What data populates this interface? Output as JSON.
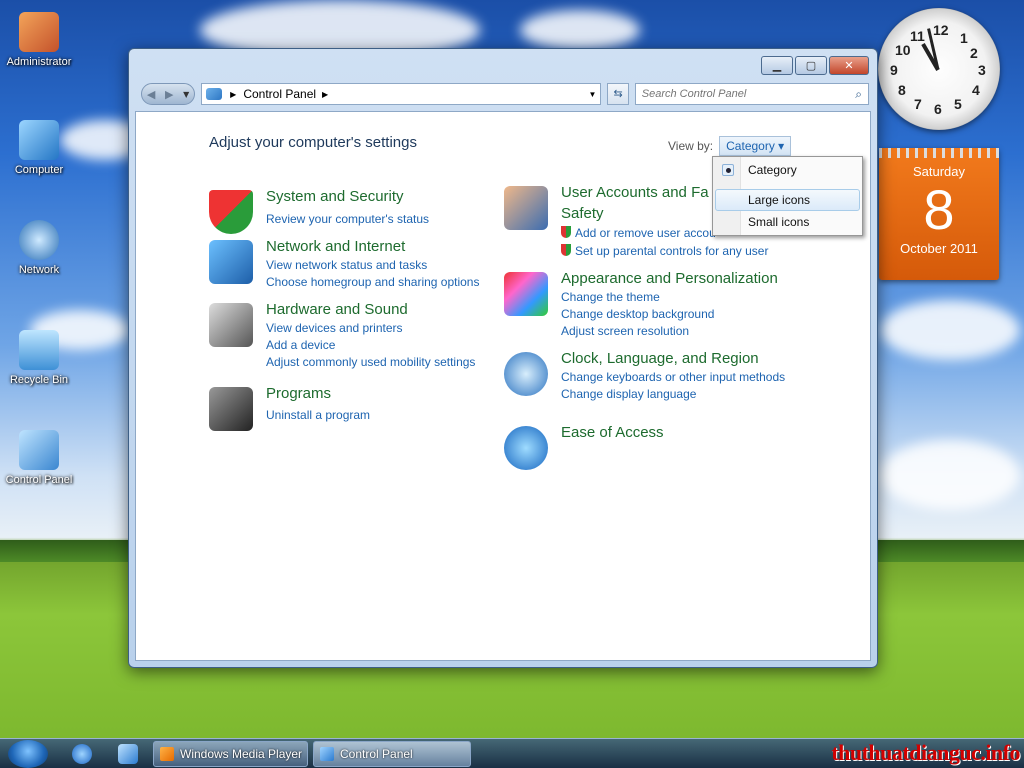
{
  "desktop": {
    "icons": [
      {
        "label": "Administrator"
      },
      {
        "label": "Computer"
      },
      {
        "label": "Network"
      },
      {
        "label": "Recycle Bin"
      },
      {
        "label": "Control Panel"
      }
    ]
  },
  "gadgets": {
    "clock": {
      "numbers": [
        "12",
        "1",
        "2",
        "3",
        "4",
        "5",
        "6",
        "7",
        "8",
        "9",
        "10",
        "11"
      ]
    },
    "calendar": {
      "day": "Saturday",
      "date": "8",
      "month": "October 2011"
    }
  },
  "window": {
    "controls": {
      "minimize": "▁",
      "maximize": "▢",
      "close": "✕"
    },
    "address": {
      "crumb": "Control Panel"
    },
    "search": {
      "placeholder": "Search Control Panel"
    },
    "heading": "Adjust your computer's settings",
    "view_by": {
      "label": "View by:",
      "selected": "Category"
    },
    "categories_left": [
      {
        "title": "System and Security",
        "links": [
          "Review your computer's status"
        ]
      },
      {
        "title": "Network and Internet",
        "links": [
          "View network status and tasks",
          "Choose homegroup and sharing options"
        ]
      },
      {
        "title": "Hardware and Sound",
        "links": [
          "View devices and printers",
          "Add a device",
          "Adjust commonly used mobility settings"
        ]
      },
      {
        "title": "Programs",
        "links": [
          "Uninstall a program"
        ]
      }
    ],
    "categories_right": [
      {
        "title_line1": "User Accounts and Fa",
        "title_line2": "Safety",
        "links": [
          "Add or remove user accou",
          "Set up parental controls for any user"
        ]
      },
      {
        "title": "Appearance and Personalization",
        "links": [
          "Change the theme",
          "Change desktop background",
          "Adjust screen resolution"
        ]
      },
      {
        "title": "Clock, Language, and Region",
        "links": [
          "Change keyboards or other input methods",
          "Change display language"
        ]
      },
      {
        "title": "Ease of Access",
        "links": []
      }
    ],
    "view_menu": {
      "items": [
        "Category",
        "Large icons",
        "Small icons"
      ]
    }
  },
  "taskbar": {
    "tasks": [
      "Windows Media Player",
      "Control Panel"
    ],
    "watermark": "thuthuatdianguc.info"
  },
  "colors": {
    "link": "#1e64b0",
    "category_title": "#1d6b2e",
    "calendar": "#e8670f"
  }
}
